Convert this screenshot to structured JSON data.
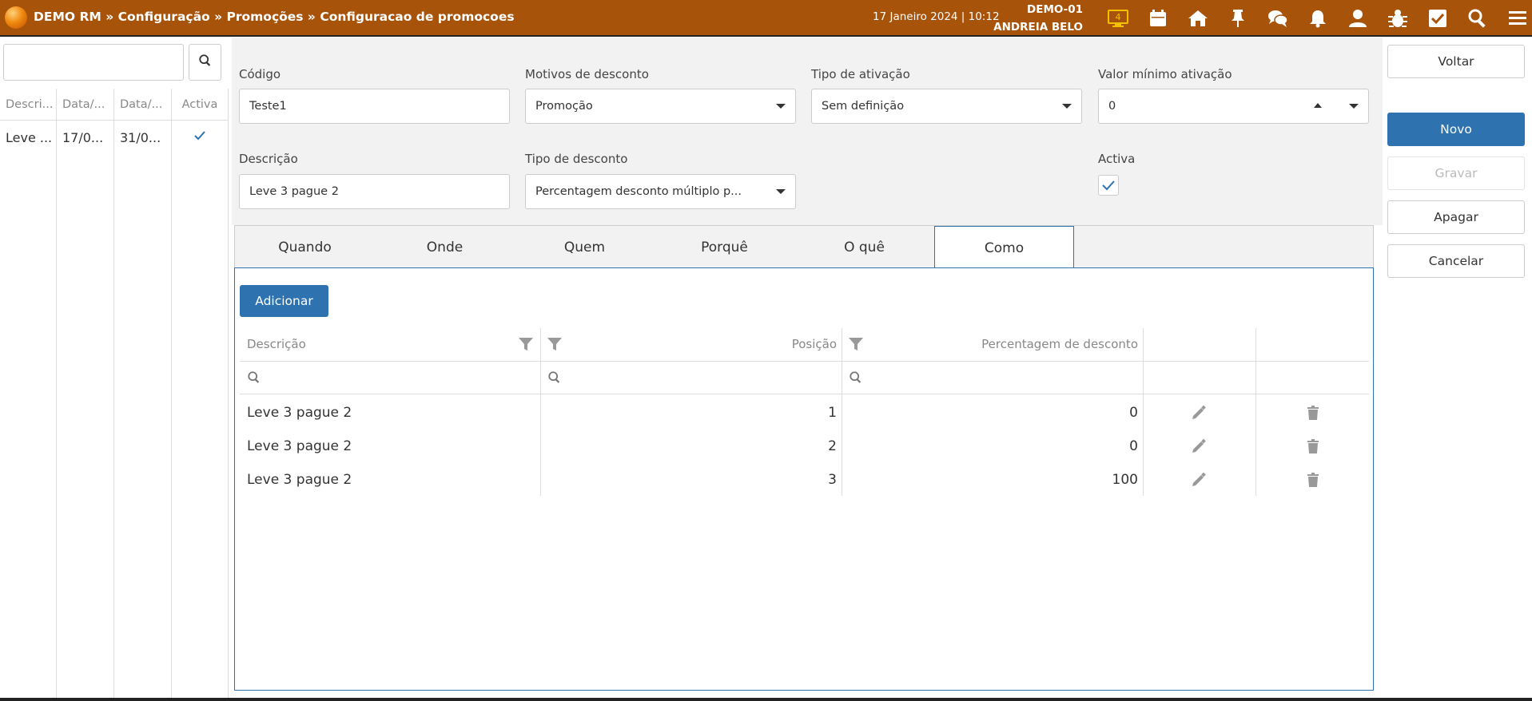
{
  "header": {
    "breadcrumb": "DEMO RM » Configuração » Promoções » Configuracao de promocoes",
    "datetime": "17 Janeiro 2024 | 10:12",
    "workstation": "DEMO-01",
    "user": "ANDREIA BELO",
    "notification_badge": "4",
    "icons": [
      "monitor-icon",
      "calendar-icon",
      "home-icon",
      "pin-icon",
      "chat-icon",
      "bell-icon",
      "user-icon",
      "bug-icon",
      "checkbox-icon",
      "search-icon",
      "menu-icon"
    ]
  },
  "left_panel": {
    "search_value": "",
    "columns": [
      "Descri...",
      "Data/...",
      "Data/...",
      "Activa"
    ],
    "rows": [
      {
        "descricao": "Leve ...",
        "data_inicio": "17/0...",
        "data_fim": "31/0...",
        "activa": true
      }
    ]
  },
  "form": {
    "codigo": {
      "label": "Código",
      "value": "Teste1"
    },
    "motivos": {
      "label": "Motivos de desconto",
      "value": "Promoção"
    },
    "tipo_ativacao": {
      "label": "Tipo de ativação",
      "value": "Sem definição"
    },
    "valor_minimo": {
      "label": "Valor mínimo ativação",
      "value": "0"
    },
    "descricao": {
      "label": "Descrição",
      "value": "Leve 3 pague 2"
    },
    "tipo_desconto": {
      "label": "Tipo de desconto",
      "value": "Percentagem desconto múltiplo p..."
    },
    "activa": {
      "label": "Activa",
      "checked": true
    }
  },
  "tabs": [
    "Quando",
    "Onde",
    "Quem",
    "Porquê",
    "O quê",
    "Como"
  ],
  "active_tab": "Como",
  "panel": {
    "add_label": "Adicionar",
    "columns": {
      "descricao": "Descrição",
      "posicao": "Posição",
      "percentagem": "Percentagem de desconto"
    },
    "rows": [
      {
        "descricao": "Leve 3 pague 2",
        "posicao": "1",
        "percentagem": "0"
      },
      {
        "descricao": "Leve 3 pague 2",
        "posicao": "2",
        "percentagem": "0"
      },
      {
        "descricao": "Leve 3 pague 2",
        "posicao": "3",
        "percentagem": "100"
      }
    ]
  },
  "actions": {
    "voltar": "Voltar",
    "novo": "Novo",
    "gravar": "Gravar",
    "apagar": "Apagar",
    "cancelar": "Cancelar"
  },
  "colors": {
    "header": "#a8530a",
    "primary": "#2f72b0"
  }
}
